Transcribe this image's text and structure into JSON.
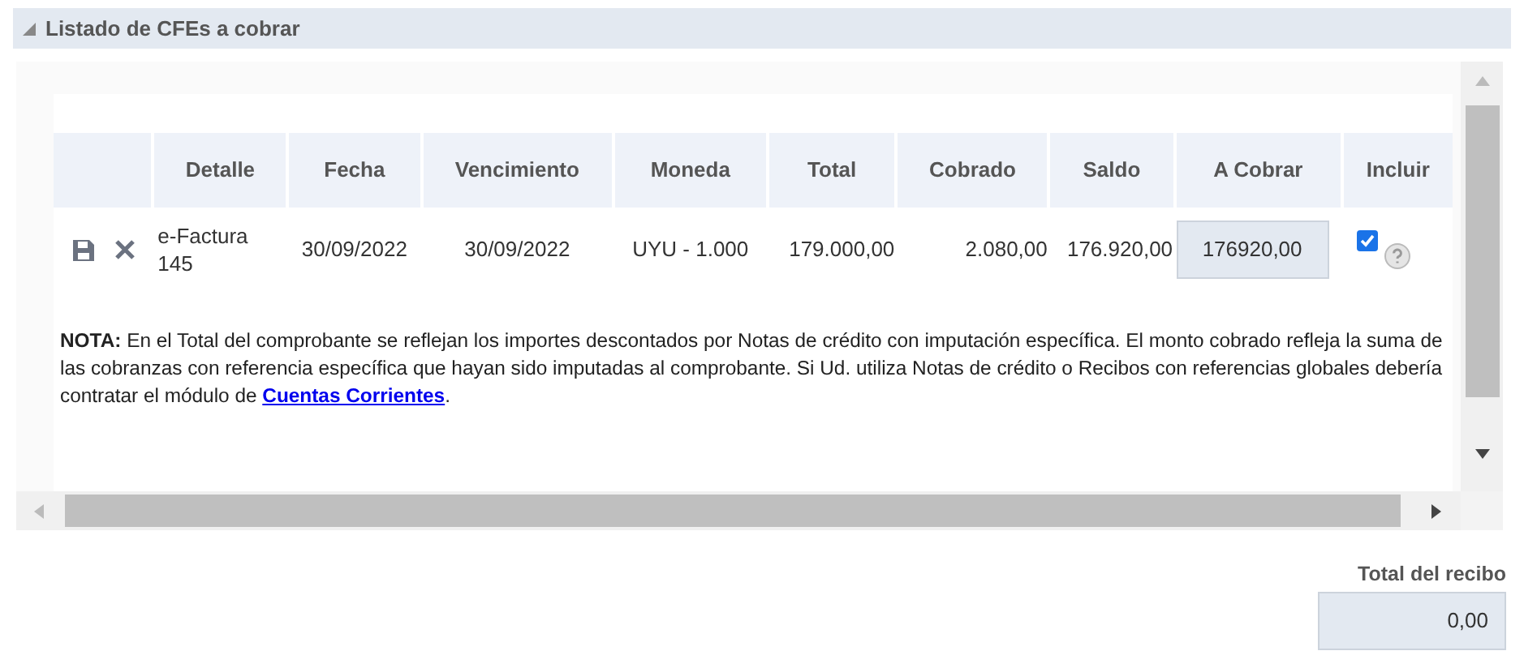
{
  "section": {
    "title": "Listado de CFEs a cobrar",
    "expanded": true
  },
  "table": {
    "columns": [
      "Detalle",
      "Fecha",
      "Vencimiento",
      "Moneda",
      "Total",
      "Cobrado",
      "Saldo",
      "A Cobrar",
      "Incluir"
    ],
    "rows": [
      {
        "detalle": "e-Factura 145",
        "fecha": "30/09/2022",
        "vencimiento": "30/09/2022",
        "moneda": "UYU - 1.000",
        "total": "179.000,00",
        "cobrado": "2.080,00",
        "saldo": "176.920,00",
        "a_cobrar": "176920,00",
        "incluir": true
      }
    ]
  },
  "note": {
    "text": "**NOTA:** En el Total del comprobante se reflejan los importes descontados por Notas de crédito con imputación específica. El monto cobrado refleja la suma de las cobranzas con referencia específica que hayan sido imputadas al comprobante. Si Ud. utiliza Notas de crédito o Recibos con referencias globales debería contratar el módulo de ",
    "link": "Cuentas Corrientes",
    "after": "."
  },
  "total_recibo": {
    "label": "Total del recibo",
    "value": "0,00"
  }
}
